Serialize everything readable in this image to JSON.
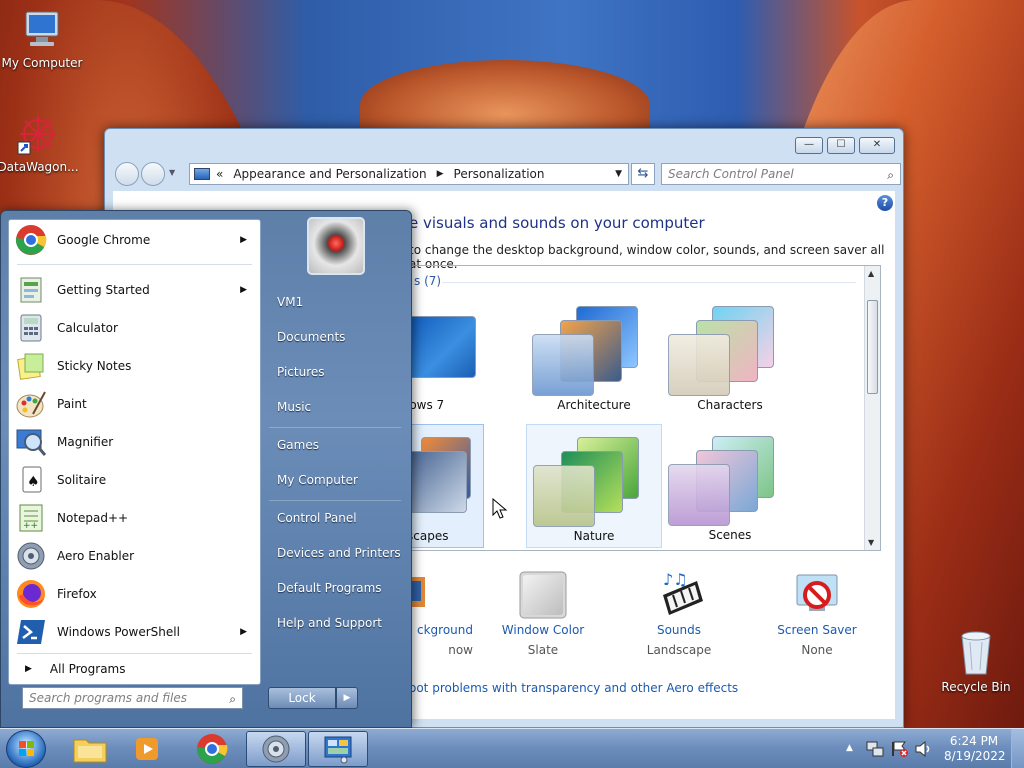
{
  "desktop": {
    "icons": [
      {
        "label": "My Computer"
      },
      {
        "label": "DataWagon..."
      },
      {
        "label": "Recycle Bin"
      }
    ]
  },
  "window": {
    "controls": {
      "minimize": "—",
      "maximize": "☐",
      "close": "✕"
    },
    "address": {
      "prefix": "«",
      "crumbs": [
        "Appearance and Personalization",
        "Personalization"
      ]
    },
    "search_placeholder": "Search Control Panel",
    "heading": "e visuals and sounds on your computer",
    "subheading": "to change the desktop background, window color, sounds, and screen saver all at once.",
    "group_label": "s (7)",
    "themes": [
      {
        "name": "lows 7"
      },
      {
        "name": "Architecture"
      },
      {
        "name": "Characters"
      },
      {
        "name": "scapes"
      },
      {
        "name": "Nature"
      },
      {
        "name": "Scenes"
      }
    ],
    "bottom_items": [
      {
        "label": "ckground",
        "value": "now"
      },
      {
        "label": "Window Color",
        "value": "Slate"
      },
      {
        "label": "Sounds",
        "value": "Landscape"
      },
      {
        "label": "Screen Saver",
        "value": "None"
      }
    ],
    "troubleshoot": "oot problems with transparency and other Aero effects"
  },
  "start_menu": {
    "programs": [
      {
        "label": "Google Chrome",
        "submenu": true
      },
      {
        "label": "Getting Started",
        "submenu": true
      },
      {
        "label": "Calculator",
        "submenu": false
      },
      {
        "label": "Sticky Notes",
        "submenu": false
      },
      {
        "label": "Paint",
        "submenu": false
      },
      {
        "label": "Magnifier",
        "submenu": false
      },
      {
        "label": "Solitaire",
        "submenu": false
      },
      {
        "label": "Notepad++",
        "submenu": false
      },
      {
        "label": "Aero Enabler",
        "submenu": false
      },
      {
        "label": "Firefox",
        "submenu": false
      },
      {
        "label": "Windows PowerShell",
        "submenu": true
      }
    ],
    "all_programs": "All Programs",
    "search_placeholder": "Search programs and files",
    "right_links": [
      "VM1",
      "Documents",
      "Pictures",
      "Music",
      "Games",
      "My Computer",
      "Control Panel",
      "Devices and Printers",
      "Default Programs",
      "Help and Support"
    ],
    "lock_label": "Lock"
  },
  "taskbar": {
    "time": "6:24 PM",
    "date": "8/19/2022"
  }
}
